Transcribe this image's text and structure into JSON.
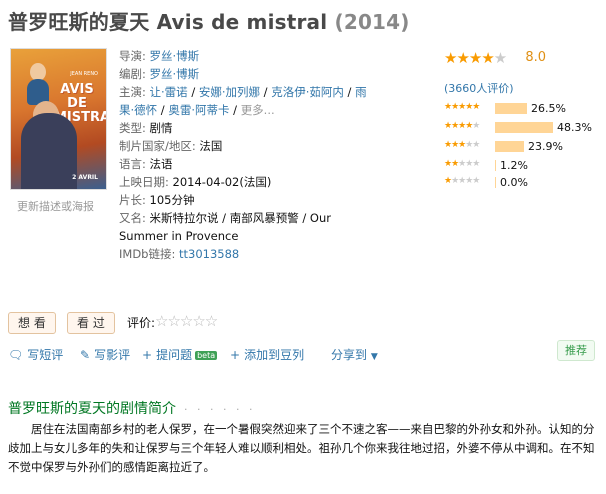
{
  "title": {
    "name": "普罗旺斯的夏天 Avis de mistral",
    "year": "(2014)"
  },
  "poster": {
    "title_text": "AVIS DE MISTRAL",
    "actor_text": "JEAN RENO",
    "date_text": "2 AVRIL"
  },
  "update_link": "更新描述或海报",
  "info": {
    "director_label": "导演:",
    "director": "罗丝·博斯",
    "writer_label": "编剧:",
    "writer": "罗丝·博斯",
    "cast_label": "主演:",
    "cast": [
      "让·雷诺",
      "安娜·加列娜",
      "克洛伊·茹阿内",
      "雨果·德怀",
      "奥雷·阿蒂卡"
    ],
    "cast_more": "更多...",
    "genre_label": "类型:",
    "genre": "剧情",
    "country_label": "制片国家/地区:",
    "country": "法国",
    "language_label": "语言:",
    "language": "法语",
    "release_label": "上映日期:",
    "release": "2014-04-02(法国)",
    "runtime_label": "片长:",
    "runtime": "105分钟",
    "aka_label": "又名:",
    "aka": "米斯特拉尔说 / 南部风暴预警 / Our Summer in Provence",
    "imdb_label": "IMDb链接:",
    "imdb": "tt3013588"
  },
  "rating": {
    "score": "8.0",
    "score_value": 8.0,
    "votes_text": "(3660人评价)",
    "distribution": [
      {
        "stars": 5,
        "pct_text": "26.5%",
        "pct": 26.5
      },
      {
        "stars": 4,
        "pct_text": "48.3%",
        "pct": 48.3
      },
      {
        "stars": 3,
        "pct_text": "23.9%",
        "pct": 23.9
      },
      {
        "stars": 2,
        "pct_text": "1.2%",
        "pct": 1.2
      },
      {
        "stars": 1,
        "pct_text": "0.0%",
        "pct": 0.0
      }
    ]
  },
  "buttons": {
    "want": "想 看",
    "seen": "看 过",
    "rate_label": "评价:"
  },
  "actions": {
    "short_review": "写短评",
    "review": "写影评",
    "question": "提问题",
    "beta": "beta",
    "doulist": "添加到豆列",
    "share": "分享到",
    "recommend": "推荐"
  },
  "section": {
    "title": "普罗旺斯的夏天的剧情简介",
    "dots": "· · · · · ·"
  },
  "summary": "居住在法国南部乡村的老人保罗，在一个暑假突然迎来了三个不速之客——来自巴黎的外孙女和外孙。认知的分歧加上与女儿多年的失和让保罗与三个年轻人难以顺利相处。祖孙几个你来我往地过招，外婆不停从中调和。在不知不觉中保罗与外孙们的感情距离拉近了。",
  "colors": {
    "link": "#3377aa",
    "green": "#007722",
    "star": "#f99b01",
    "bar": "#ffd596"
  }
}
